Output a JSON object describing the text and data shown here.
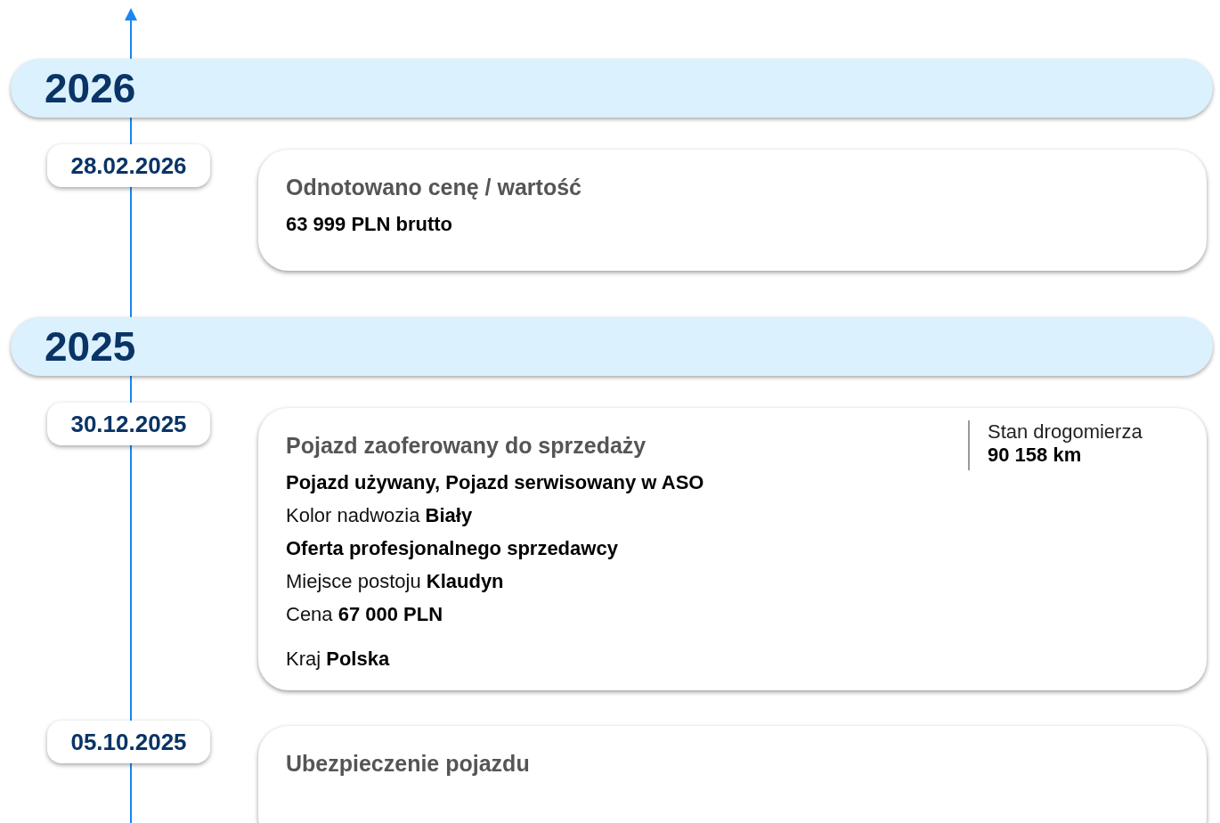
{
  "sections": [
    {
      "year": "2026",
      "events": [
        {
          "date": "28.02.2026",
          "title": "Odnotowano cenę / wartość",
          "lines": [
            {
              "value": "63 999 PLN brutto"
            }
          ]
        }
      ]
    },
    {
      "year": "2025",
      "events": [
        {
          "date": "30.12.2025",
          "title": "Pojazd zaoferowany do sprzedaży",
          "side": {
            "label": "Stan drogomierza",
            "value": "90 158 km"
          },
          "lines": [
            {
              "value": "Pojazd używany, Pojazd serwisowany w ASO"
            },
            {
              "label": "Kolor nadwozia",
              "value": "Biały"
            },
            {
              "value": "Oferta profesjonalnego sprzedawcy"
            },
            {
              "label": "Miejsce postoju",
              "value": "Klaudyn"
            },
            {
              "label": "Cena",
              "value": "67 000 PLN"
            },
            {
              "label": "Kraj",
              "value": "Polska"
            }
          ]
        },
        {
          "date": "05.10.2025",
          "title": "Ubezpieczenie pojazdu"
        }
      ]
    }
  ]
}
